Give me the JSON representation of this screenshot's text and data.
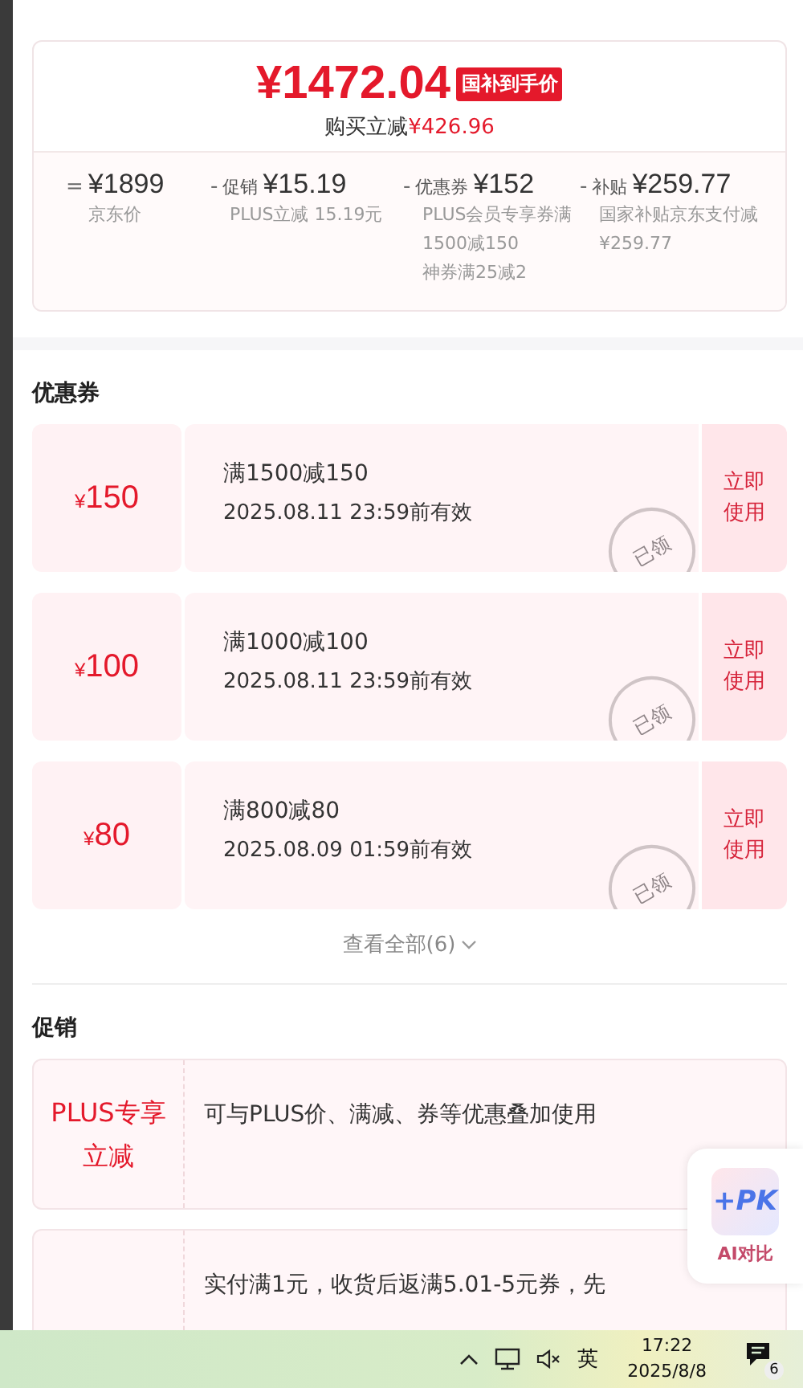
{
  "price_card": {
    "final_price": "¥1472.04",
    "badge": "国补到手价",
    "saving_label": "购买立减",
    "saving_amount": "¥426.96",
    "breakdown": [
      {
        "op": "=",
        "amount": "¥1899",
        "notes": [
          "京东价"
        ]
      },
      {
        "op": "-",
        "label": "促销",
        "amount": "¥15.19",
        "notes": [
          "PLUS立减 15.19元"
        ]
      },
      {
        "op": "-",
        "label": "优惠券",
        "amount": "¥152",
        "notes": [
          "PLUS会员专享券满1500减150",
          "神券满25减2"
        ]
      },
      {
        "op": "-",
        "label": "补贴",
        "amount": "¥259.77",
        "notes": [
          "国家补贴京东支付减¥259.77"
        ]
      }
    ]
  },
  "coupons": {
    "title": "优惠券",
    "items": [
      {
        "currency": "¥",
        "amount": "150",
        "condition": "满1500减150",
        "validity": "2025.08.11 23:59前有效",
        "stamp": "已领",
        "action": "立即使用"
      },
      {
        "currency": "¥",
        "amount": "100",
        "condition": "满1000减100",
        "validity": "2025.08.11 23:59前有效",
        "stamp": "已领",
        "action": "立即使用"
      },
      {
        "currency": "¥",
        "amount": "80",
        "condition": "满800减80",
        "validity": "2025.08.09 01:59前有效",
        "stamp": "已领",
        "action": "立即使用"
      }
    ],
    "view_all": "查看全部(6)"
  },
  "promotions": {
    "title": "促销",
    "items": [
      {
        "tag": "PLUS专享立减",
        "description": "可与PLUS价、满减、券等优惠叠加使用"
      },
      {
        "description": "实付满1元，收货后返满5.01-5元券，先"
      }
    ]
  },
  "ai_compare": {
    "icon_text": "+PK",
    "label": "AI对比"
  },
  "taskbar": {
    "ime": "英",
    "time": "17:22",
    "date": "2025/8/8",
    "notifications": "6"
  }
}
